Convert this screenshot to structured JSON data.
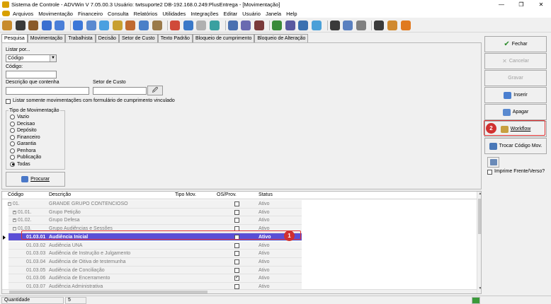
{
  "window": {
    "title": "Sistema de Controle - ADVWin  V 7.05.00.3  Usuário: twtsuporte2  DB-192.168.0.249:PlusEntrega - [Movimentação]",
    "minimize": "—",
    "restore": "❐",
    "close": "✕"
  },
  "menu": [
    "Arquivos",
    "Movimentação",
    "Financeiro",
    "Consulta",
    "Relatórios",
    "Utilidades",
    "Integrações",
    "Editar",
    "Usuário",
    "Janela",
    "Help"
  ],
  "toolbar": {
    "icon_colors": [
      "#c78a2b",
      "#3a3a3a",
      "#8a5a2a",
      "#3a6fd0",
      "#4a7fd8",
      "#3b77d8",
      "#5a8ad0",
      "#4aa0e0",
      "#c8a030",
      "#c06a30",
      "#4a80c8",
      "#9a7a4a",
      "#d04a3a",
      "#3a78c8",
      "#b0b0b0",
      "#3aa0a0",
      "#4a70b0",
      "#6a6ab0",
      "#7a3a3a",
      "#3a8a3a",
      "#5a5aa0",
      "#3a70b0",
      "#4aa0d8",
      "#3a3a3a",
      "#5a80c0",
      "#808080",
      "#3a3a3a",
      "#d08a30",
      "#e07a20"
    ]
  },
  "tabs": [
    {
      "label": "Pesquisa",
      "active": true
    },
    {
      "label": "Movimentação",
      "active": false
    },
    {
      "label": "Trabalhista",
      "active": false
    },
    {
      "label": "Decisão",
      "active": false
    },
    {
      "label": "Setor de Custo",
      "active": false
    },
    {
      "label": "Texto Padrão",
      "active": false
    },
    {
      "label": "Bloqueio de cumprimento",
      "active": false
    },
    {
      "label": "Bloqueio de Alteração",
      "active": false
    }
  ],
  "search": {
    "listar_por_label": "Listar por...",
    "listar_por_value": "Código",
    "codigo_label": "Código:",
    "codigo_value": "",
    "descricao_label": "Descrição que contenha",
    "descricao_value": "",
    "setor_label": "Setor de Custo",
    "setor_value": "",
    "lookup_icon": "🖉",
    "only_with_form_label": "Listar somente movimentações com formulário de cumprimento vinculado",
    "tipo_label": "Tipo de Movimentação",
    "tipos": [
      "Vazio",
      "Decisao",
      "Depósito",
      "Financeiro",
      "Garantia",
      "Penhora",
      "Publicação",
      "Todas"
    ],
    "tipo_selected": "Todas",
    "procurar_label": "Procurar"
  },
  "side_buttons": {
    "fechar": "Fechar",
    "cancelar": "Cancelar",
    "gravar": "Gravar",
    "inserir": "Inserir",
    "apagar": "Apagar",
    "workflow": "Workflow",
    "trocar": "Trocar Código Mov.",
    "imprime": "Imprime Frente/Verso?"
  },
  "annotations": {
    "badge1": "1",
    "badge2": "2",
    "color": "#e03030"
  },
  "grid": {
    "headers": {
      "codigo": "Código",
      "descricao": "Descrição",
      "tipo": "Tipo Mov.",
      "os": "OS/Prov.",
      "status": "Status"
    },
    "rows": [
      {
        "sign": "⊟",
        "codigo": "01.",
        "descricao": "GRANDE GRUPO CONTENCIOSO",
        "tipo": "",
        "checked": false,
        "status": "Ativo",
        "selected": false,
        "level": 0
      },
      {
        "sign": "⊞",
        "codigo": "01.01.",
        "descricao": "Grupo Petição",
        "tipo": "",
        "checked": false,
        "status": "Ativo",
        "selected": false,
        "level": 1
      },
      {
        "sign": "⊞",
        "codigo": "01.02.",
        "descricao": "Grupo Defesa",
        "tipo": "",
        "checked": false,
        "status": "Ativo",
        "selected": false,
        "level": 1
      },
      {
        "sign": "⊟",
        "codigo": "01.03.",
        "descricao": "Grupo Audiências e Sessões",
        "tipo": "",
        "checked": false,
        "status": "Ativo",
        "selected": false,
        "level": 1
      },
      {
        "sign": "",
        "codigo": "01.03.01",
        "descricao": "Audiência Inicial",
        "tipo": "",
        "checked": false,
        "status": "Ativo",
        "selected": true,
        "level": 2
      },
      {
        "sign": "",
        "codigo": "01.03.02",
        "descricao": "Audiência UNA",
        "tipo": "",
        "checked": false,
        "status": "Ativo",
        "selected": false,
        "level": 2
      },
      {
        "sign": "",
        "codigo": "01.03.03",
        "descricao": "Audiência de Instrução e Julgamento",
        "tipo": "",
        "checked": false,
        "status": "Ativo",
        "selected": false,
        "level": 2
      },
      {
        "sign": "",
        "codigo": "01.03.04",
        "descricao": "Audiência de Oitiva de testemunha",
        "tipo": "",
        "checked": false,
        "status": "Ativo",
        "selected": false,
        "level": 2
      },
      {
        "sign": "",
        "codigo": "01.03.05",
        "descricao": "Audiência de Conciliação",
        "tipo": "",
        "checked": false,
        "status": "Ativo",
        "selected": false,
        "level": 2
      },
      {
        "sign": "",
        "codigo": "01.03.06",
        "descricao": "Audiência de Encerramento",
        "tipo": "",
        "checked": true,
        "status": "Ativo",
        "selected": false,
        "level": 2
      },
      {
        "sign": "",
        "codigo": "01.03.07",
        "descricao": "Audiência Administrativa",
        "tipo": "",
        "checked": false,
        "status": "Ativo",
        "selected": false,
        "level": 2
      }
    ]
  },
  "status": {
    "quantidade_label": "Quantidade",
    "quantidade_value": "5"
  }
}
